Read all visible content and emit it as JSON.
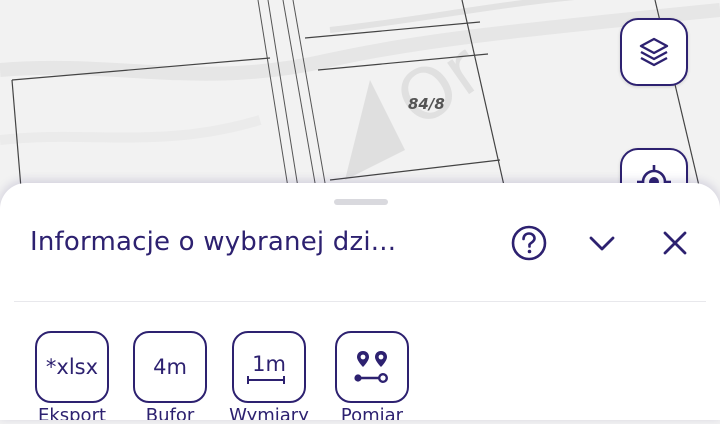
{
  "map": {
    "parcel_label": "84/8",
    "layers_button": "layers-icon",
    "locate_button": "locate-icon"
  },
  "sheet": {
    "title": "Informacje o wybranej dzi...",
    "help_icon": "help-circle-icon",
    "collapse_icon": "chevron-down-icon",
    "close_icon": "close-icon"
  },
  "tools": [
    {
      "icon_text": "*xlsx",
      "label": "Eksport"
    },
    {
      "icon_text": "4m",
      "label": "Bufor"
    },
    {
      "icon_text": "1m",
      "label": "Wymiary"
    },
    {
      "icon": "route-pin-icon",
      "label": "Pomiar"
    }
  ],
  "colors": {
    "accent": "#2d2170",
    "map_background": "#f3f3f3",
    "parcel_line": "#444444"
  }
}
